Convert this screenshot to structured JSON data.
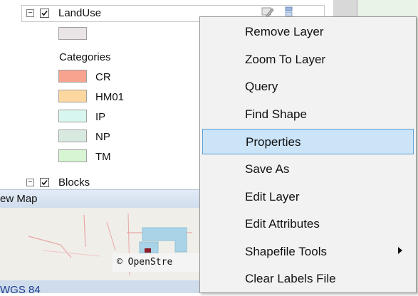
{
  "tree": {
    "layers": [
      {
        "name": "LandUse",
        "checked": true,
        "expanded": true
      },
      {
        "name": "Blocks",
        "checked": true,
        "expanded": true
      }
    ],
    "categories_heading": "Categories",
    "default_swatch_color": "#ebe4e6",
    "categories": [
      {
        "label": "CR",
        "color": "#f7a38f"
      },
      {
        "label": "HM01",
        "color": "#fdd7a0"
      },
      {
        "label": "IP",
        "color": "#d7f6ef"
      },
      {
        "label": "NP",
        "color": "#d8eadf"
      },
      {
        "label": "TM",
        "color": "#d7f4d3"
      }
    ]
  },
  "overview": {
    "title_fragment": "ew Map",
    "attribution_fragment": "© OpenStre",
    "crs_fragment": "WGS 84"
  },
  "context_menu": {
    "items": [
      {
        "label": "Remove Layer"
      },
      {
        "label": "Zoom To Layer"
      },
      {
        "label": "Query"
      },
      {
        "label": "Find Shape"
      },
      {
        "label": "Properties",
        "highlighted": true
      },
      {
        "label": "Save As"
      },
      {
        "label": "Edit Layer"
      },
      {
        "label": "Edit Attributes"
      },
      {
        "label": "Shapefile Tools",
        "has_submenu": true
      },
      {
        "label": "Clear Labels File"
      }
    ]
  },
  "colors": {
    "menu_highlight": "#cce4f7",
    "menu_highlight_border": "#5aa0d8",
    "crs_text": "#1a3d8f"
  }
}
